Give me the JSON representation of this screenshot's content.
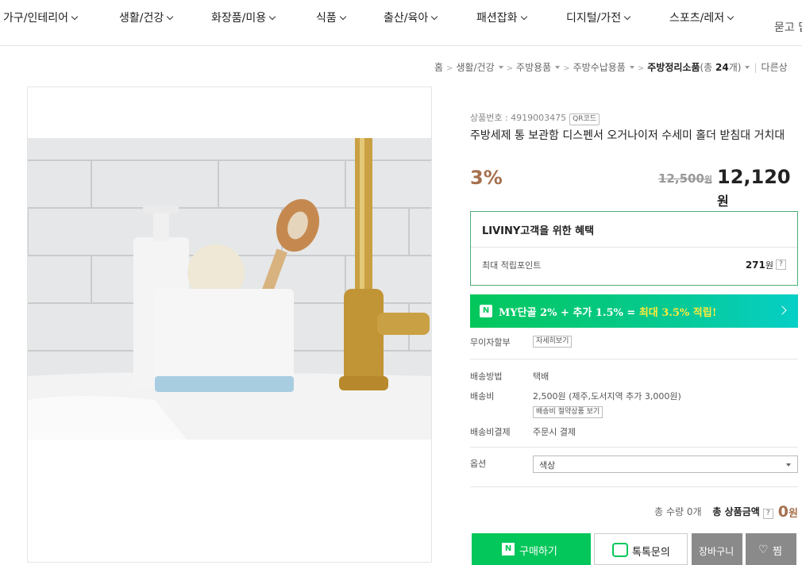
{
  "nav": {
    "items": [
      {
        "label": "가구/인테리어"
      },
      {
        "label": "생활/건강"
      },
      {
        "label": "화장품/미용"
      },
      {
        "label": "식품"
      },
      {
        "label": "출산/육아"
      },
      {
        "label": "패션잡화"
      },
      {
        "label": "디지털/가전"
      },
      {
        "label": "스포츠/레저"
      }
    ],
    "ask_label": "묻고 답"
  },
  "breadcrumb": {
    "home": "홈",
    "items": [
      "생활/건강",
      "주방용품",
      "주방수납용품"
    ],
    "current": "주방정리소품",
    "count_prefix": "(총 ",
    "count": "24",
    "count_suffix": "개)",
    "other": "다른상"
  },
  "product": {
    "number_label": "상품번호 : 4919003475",
    "qr_label": "QR코드",
    "title": "주방세제 통 보관함 디스펜서 오거나이저 수세미 홀더 받침대 거치대",
    "discount": "3%",
    "original_price": "12,500",
    "original_unit": "원",
    "price": "12,120",
    "price_unit": "원"
  },
  "benefit": {
    "title": "LIVINY고객을 위한 혜택",
    "label": "최대 적립포인트",
    "value": "271",
    "unit": "원",
    "help": "?"
  },
  "promo": {
    "badge": "N",
    "text_main": "MY단골 2% + 추가 1.5% = ",
    "text_highlight": "최대 3.5% 적립!"
  },
  "installment": {
    "label": "무이자할부",
    "button": "자세히보기"
  },
  "shipping": {
    "method_label": "배송방법",
    "method_value": "택배",
    "fee_label": "배송비",
    "fee_value": "2,500원 (제주,도서지역 추가 3,000원)",
    "save_button": "배송비 절약상품 보기",
    "payment_label": "배송비결제",
    "payment_value": "주문시 결제"
  },
  "option": {
    "label": "옵션",
    "placeholder": "색상"
  },
  "summary": {
    "qty_label": "총 수량",
    "qty_value": "0개",
    "total_label": "총 상품금액",
    "help": "?",
    "total_value": "0",
    "total_unit": "원"
  },
  "buttons": {
    "buy_badge": "N",
    "buy": "구매하기",
    "talk": "톡톡문의",
    "cart": "장바구니",
    "wish": "찜"
  },
  "colors": {
    "naver_green": "#03c75a",
    "discount_brown": "#a5704f",
    "benefit_border": "#4caf74"
  }
}
